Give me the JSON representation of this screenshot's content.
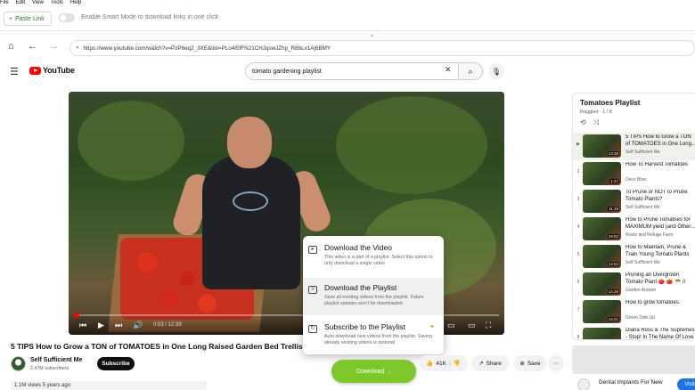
{
  "menubar": {
    "items": [
      "File",
      "Edit",
      "View",
      "Tools",
      "Help"
    ]
  },
  "app_toolbar": {
    "paste_label": "Paste Link",
    "smart_mode_label": "Enable Smart Mode to download links in one click"
  },
  "browser": {
    "url": "https://www.youtube.com/watch?v=PzP6eq2_3XE&list=PLo4I5fFN21CHJqswJZhp_R8bLx1Aj6BMY"
  },
  "youtube": {
    "logo_text": "YouTube",
    "search_query": "tomato gardening playlist"
  },
  "player": {
    "time": "0:03 / 12:39",
    "colors": {
      "progress": "#ff0000"
    }
  },
  "download_menu": {
    "options": [
      {
        "title": "Download the Video",
        "desc": "This video is a part of a playlist. Select this option to only download a single video"
      },
      {
        "title": "Download the Playlist",
        "desc": "Save all existing videos from the playlist. Future playlist updates won't be downloaded"
      },
      {
        "title": "Subscribe to the Playlist",
        "desc": "Auto-download new videos from the playlist. Saving already existing videos is optional"
      }
    ],
    "download_label": "Download",
    "colors": {
      "download_button": "#7dc72a"
    }
  },
  "video": {
    "title": "5 TIPS How to Grow a TON of TOMATOES in One Long Raised Garden Bed Trellis",
    "channel": "Self Sufficient Me",
    "subscribers": "2.47M subscribers",
    "subscribe_label": "Subscribe",
    "likes": "41K",
    "share_label": "Share",
    "save_label": "Save",
    "views": "1.1M views  5 years ago"
  },
  "playlist": {
    "title": "Tomatoes Playlist",
    "subtitle": "Reggieit - 1 / 8",
    "items": [
      {
        "idx": "▶",
        "title": "5 TIPS How to Grow a TON of TOMATOES in One Long...",
        "channel": "Self Sufficient Me",
        "duration": "13:39"
      },
      {
        "idx": "2",
        "title": "How To Harvest Tomatoes",
        "channel": "Deco Bliss",
        "duration": "1:47"
      },
      {
        "idx": "3",
        "title": "To Prune or NOT to Prune Tomato Plants?",
        "channel": "Self Sufficient Me",
        "duration": "11:19"
      },
      {
        "idx": "4",
        "title": "How to Prune Tomatoes for MAXIMUM yield (and Other...",
        "channel": "Roots and Refuge Farm",
        "duration": "19:52"
      },
      {
        "idx": "5",
        "title": "How to Maintain, Prune & Train Young Tomato Plants",
        "channel": "Self Sufficient Me",
        "duration": "13:54"
      },
      {
        "idx": "6",
        "title": "Pruning an Overgrown Tomato Plant 🍅 🍅 🥗 // Garden...",
        "channel": "Garden Answer",
        "duration": "14:26"
      },
      {
        "idx": "7",
        "title": "How to grow tomatoes.",
        "channel": "Green Side Up",
        "duration": "14:21"
      },
      {
        "idx": "8",
        "title": "Diana Ross & The Supremes - Stop! In The Name Of Love",
        "channel": "",
        "duration": ""
      }
    ]
  },
  "ad": {
    "title": "Dental Implants For New",
    "visit_label": "Visit"
  }
}
